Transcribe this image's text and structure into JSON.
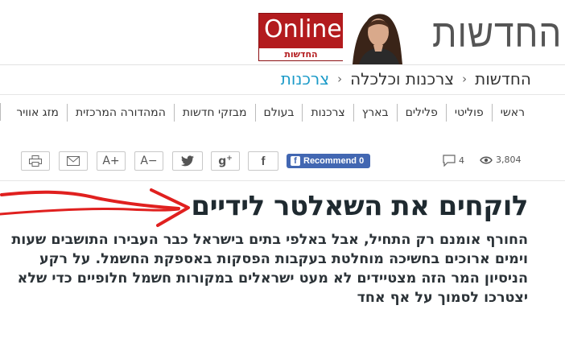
{
  "header": {
    "site_name": "החדשות",
    "badge_word": "Online",
    "badge_sub": "החדשות"
  },
  "breadcrumb": [
    "החדשות",
    "צרכנות וכלכלה",
    "צרכנות"
  ],
  "breadcrumb_sep": "‹",
  "nav": {
    "items": [
      "ראשי",
      "פוליטי",
      "פלילים",
      "בארץ",
      "צרכנות",
      "בעולם",
      "מבזקי חדשות",
      "המהדורה המרכזית",
      "מזג אוויר"
    ]
  },
  "toolbar": {
    "font_increase": "A+",
    "font_decrease": "A−",
    "recommend_label": "Recommend 0",
    "comments_count": "4",
    "views_count": "3,804",
    "icons": [
      "print-icon",
      "mail-icon",
      "twitter-icon",
      "google-plus-icon",
      "facebook-icon",
      "comment-icon",
      "eye-icon"
    ]
  },
  "article": {
    "headline": "לוקחים את השאלטר לידיים",
    "summary_lines": [
      "החורף אומנם רק התחיל, אבל באלפי בתים בישראל כבר העבירו התושבים שעות",
      "וימים ארוכים בחשיכה מוחלטת בעקבות הפסקות באספקת החשמל. על רקע",
      "הניסיון המר הזה מצטיידים לא מעט ישראלים במקורות חשמל חלופיים כדי שלא",
      "יצטרכו לסמוך על אף אחד"
    ]
  },
  "colors": {
    "brand_red": "#b31b1e",
    "breadcrumb_active": "#1a9ac8",
    "facebook_blue": "#4267b2",
    "annotation_arrow": "#e0201f"
  }
}
